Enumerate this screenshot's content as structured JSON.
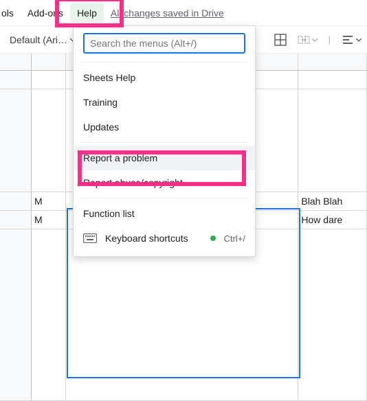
{
  "menubar": {
    "tools": "ols",
    "addons": "Add-ons",
    "help": "Help",
    "save_status": "All changes saved in Drive"
  },
  "toolbar": {
    "font_name": "Default (Ari…"
  },
  "help_menu": {
    "search_placeholder": "Search the menus (Alt+/)",
    "items": {
      "sheets_help": "Sheets Help",
      "training": "Training",
      "updates": "Updates",
      "report_problem": "Report a problem",
      "report_abuse": "Report abuse/copyright",
      "function_list": "Function list",
      "keyboard_shortcuts": "Keyboard shortcuts",
      "keyboard_shortcut_hint": "Ctrl+/"
    }
  },
  "sheet": {
    "rows": [
      {
        "a": "",
        "b": "",
        "c": ""
      },
      {
        "a": "",
        "b": "",
        "c": ""
      },
      {
        "a": "",
        "b": "",
        "c": ""
      },
      {
        "a": "",
        "b": "",
        "c": ""
      },
      {
        "a": "",
        "b": "",
        "c": ""
      },
      {
        "a": "",
        "b": "",
        "c": ""
      },
      {
        "a": "M",
        "b": "",
        "c": "Blah Blah"
      },
      {
        "a": "M",
        "b": "",
        "c": "How dare"
      }
    ]
  }
}
